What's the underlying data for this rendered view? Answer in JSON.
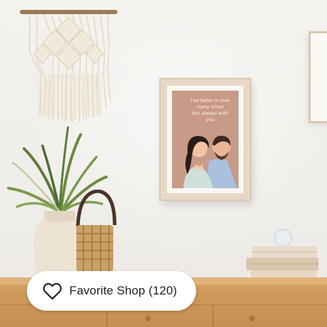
{
  "poster": {
    "quote": "I've fallen in love\nmany times\nbut always with\nyou"
  },
  "favorite": {
    "label": "Favorite Shop (120)",
    "icon": "heart-outline-icon"
  },
  "colors": {
    "wall": "#f1efeb",
    "poster_bg": "#c89a88",
    "wood": "#cf9a5d",
    "pill_bg": "#ffffff",
    "pill_text": "#222222"
  }
}
